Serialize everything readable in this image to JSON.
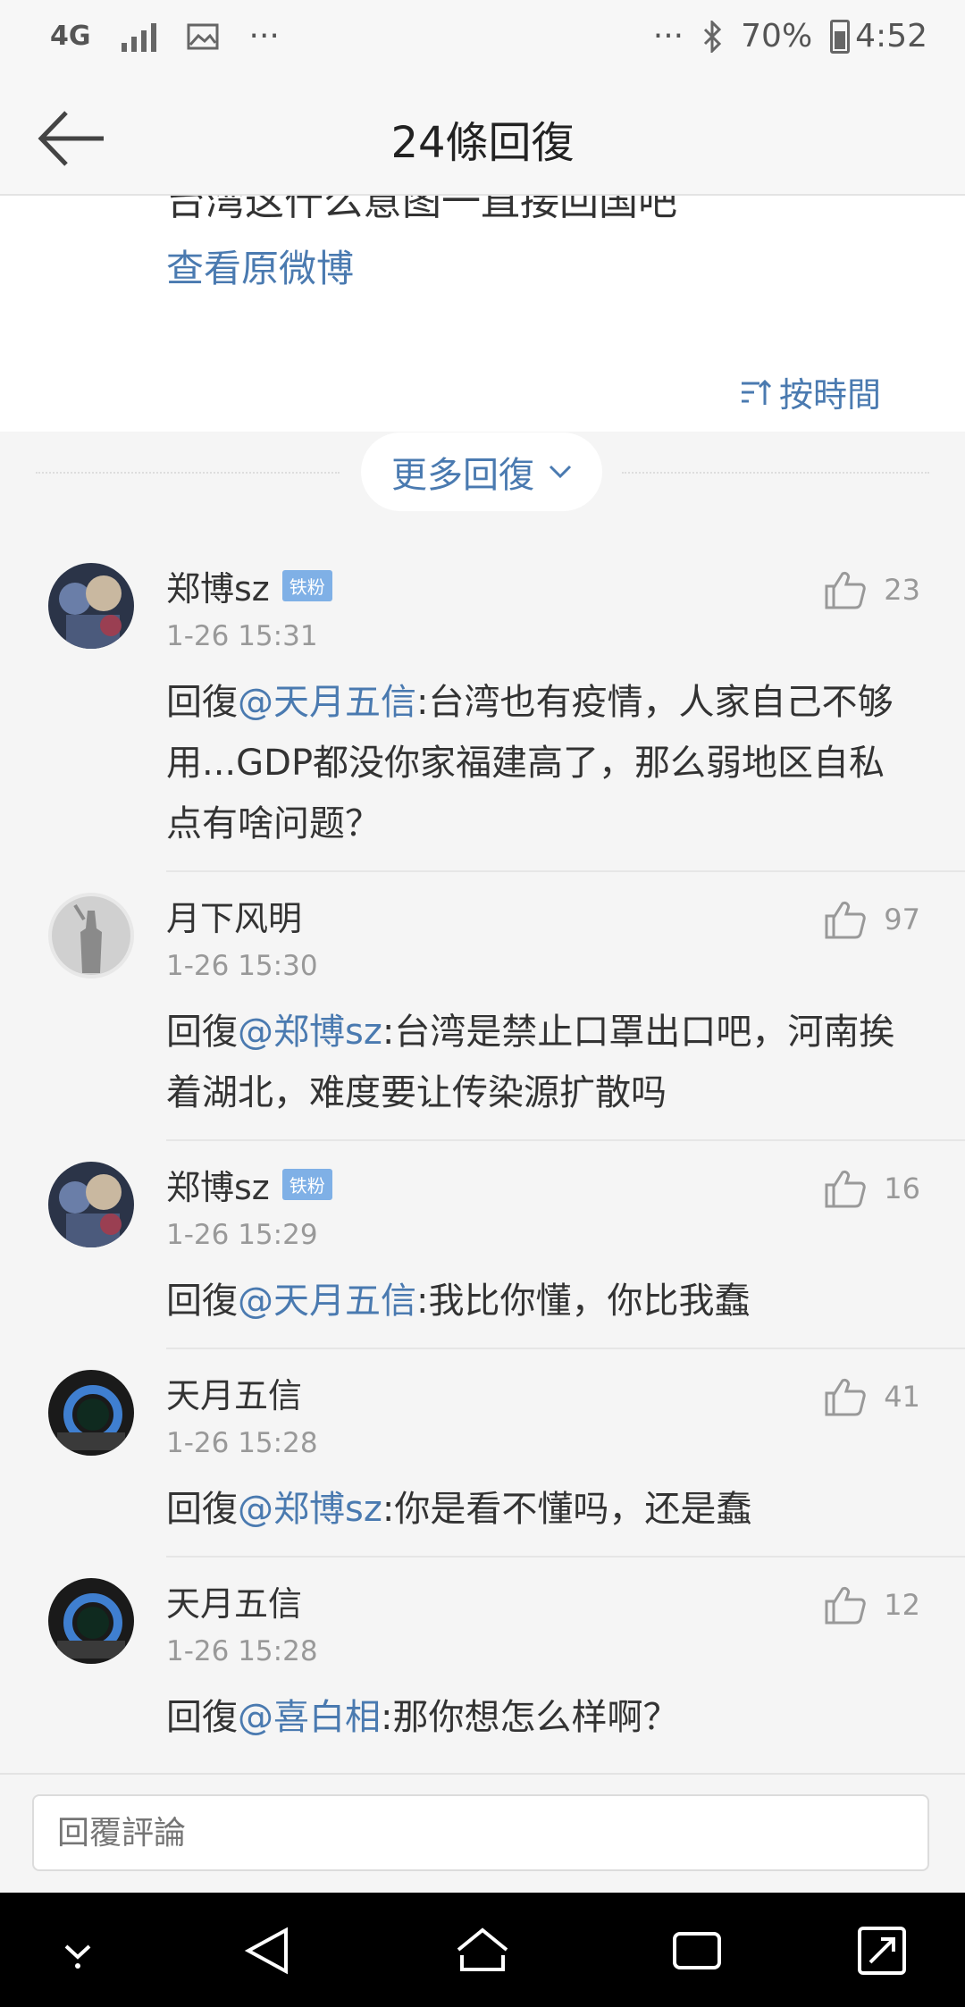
{
  "status_bar": {
    "network": "4G",
    "battery": "70%",
    "time": "4:52",
    "dots": "···",
    "right_dots": "···"
  },
  "header": {
    "title": "24條回復"
  },
  "post": {
    "cut_text": "台湾这什么意图一直接回国吧",
    "view_original": "查看原微博",
    "sort_label": "按時間"
  },
  "more_replies": {
    "label": "更多回復"
  },
  "comments": [
    {
      "name": "郑博sz",
      "badge": "铁粉",
      "time": "1-26 15:31",
      "likes": "23",
      "prefix": "回復",
      "mention": "@天月五信",
      "text": ":台湾也有疫情，人家自己不够用...GDP都没你家福建高了，那么弱地区自私点有啥问题？"
    },
    {
      "name": "月下风明",
      "badge": "",
      "time": "1-26 15:30",
      "likes": "97",
      "prefix": "回復",
      "mention": "@郑博sz",
      "text": ":台湾是禁止口罩出口吧，河南挨着湖北，难度要让传染源扩散吗"
    },
    {
      "name": "郑博sz",
      "badge": "铁粉",
      "time": "1-26 15:29",
      "likes": "16",
      "prefix": "回復",
      "mention": "@天月五信",
      "text": ":我比你懂，你比我蠢"
    },
    {
      "name": "天月五信",
      "badge": "",
      "time": "1-26 15:28",
      "likes": "41",
      "prefix": "回復",
      "mention": "@郑博sz",
      "text": ":你是看不懂吗，还是蠢"
    },
    {
      "name": "天月五信",
      "badge": "",
      "time": "1-26 15:28",
      "likes": "12",
      "prefix": "回復",
      "mention": "@喜白相",
      "text": ":那你想怎么样啊？"
    }
  ],
  "reply_bar": {
    "placeholder": "回覆評論"
  },
  "colors": {
    "link": "#4a7ab0",
    "badge": "#7fb0e6",
    "navbar": "#000000"
  }
}
